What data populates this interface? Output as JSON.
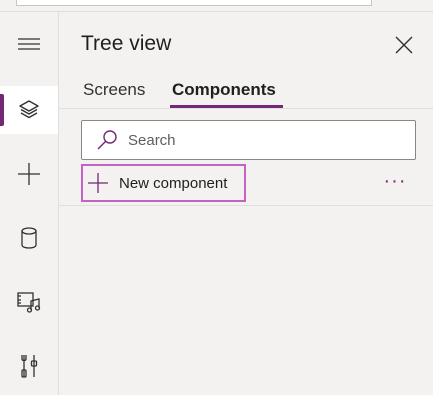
{
  "panel": {
    "title": "Tree view"
  },
  "tabs": [
    {
      "label": "Screens",
      "active": false
    },
    {
      "label": "Components",
      "active": true
    }
  ],
  "search": {
    "placeholder": "Search"
  },
  "toolbar": {
    "new_component_label": "New component",
    "more_label": "···"
  },
  "rail": {
    "items": [
      {
        "icon": "hamburger-menu-icon",
        "active": false
      },
      {
        "icon": "layers-icon",
        "active": true
      },
      {
        "icon": "plus-icon",
        "active": false
      },
      {
        "icon": "database-icon",
        "active": false
      },
      {
        "icon": "media-icon",
        "active": false
      },
      {
        "icon": "tools-icon",
        "active": false
      }
    ]
  },
  "colors": {
    "accent": "#742774",
    "focus_border": "#c563c5",
    "background": "#f3f2f1"
  }
}
